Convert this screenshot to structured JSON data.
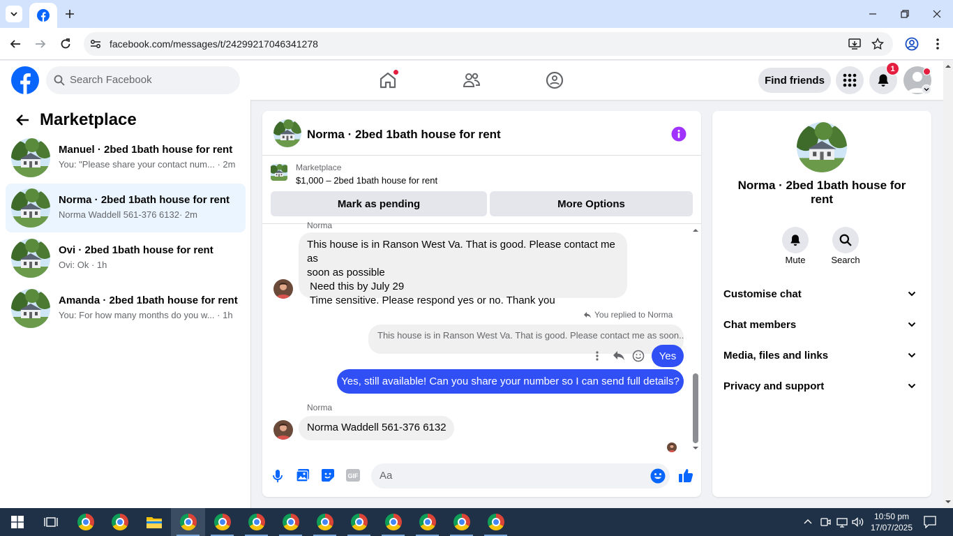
{
  "browser": {
    "url": "facebook.com/messages/t/24299217046341278",
    "tab_icon": "facebook-icon"
  },
  "header": {
    "search_placeholder": "Search Facebook",
    "find_friends": "Find friends",
    "notification_count": "1"
  },
  "left_panel": {
    "title": "Marketplace",
    "conversations": [
      {
        "name": "Manuel · 2bed 1bath house for rent",
        "preview": "You: \"Please share your contact num...",
        "time": "· 2m"
      },
      {
        "name": "Norma · 2bed 1bath house for rent",
        "preview": "Norma Waddell 561-376 6132",
        "time": "· 2m"
      },
      {
        "name": "Ovi · 2bed 1bath house for rent",
        "preview": "Ovi: Ok",
        "time": "· 1h"
      },
      {
        "name": "Amanda · 2bed 1bath house for rent",
        "preview": "You: For how many months do you w...",
        "time": "· 1h"
      }
    ]
  },
  "chat": {
    "title": "Norma · 2bed 1bath house for rent",
    "listing_label": "Marketplace",
    "listing_price": "$1,000 – 2bed 1bath house for rent",
    "mark_pending": "Mark as pending",
    "more_options": "More Options",
    "messages": {
      "sender_top": "Norma",
      "msg1_line1": "This house is in Ranson West Va. That is good. Please contact me as",
      "msg1_line2": "soon as possible",
      "msg1_line3": " Need this by July 29",
      "msg1_line4": " Time sensitive. Please respond yes or no. Thank you",
      "replied_label": "You replied to Norma",
      "quoted": "This house is in Ranson West Va. That is good. Please contact me as soon...",
      "reply_yes": "Yes",
      "out_msg": "Yes, still available! Can you share your number so I can send full details?",
      "sender_bottom": "Norma",
      "last_msg": "Norma Waddell 561-376 6132"
    },
    "composer_placeholder": "Aa"
  },
  "info_panel": {
    "title_line1": "Norma · 2bed 1bath house for",
    "title_line2": "rent",
    "mute": "Mute",
    "search": "Search",
    "sections": [
      "Customise chat",
      "Chat members",
      "Media, files and links",
      "Privacy and support"
    ]
  },
  "taskbar": {
    "time": "10:50 pm",
    "date": "17/07/2025"
  },
  "colors": {
    "fb_blue": "#0866ff",
    "outgoing_bubble": "#3050f5",
    "notification_red": "#e41e3f",
    "info_purple": "#a033ff"
  }
}
